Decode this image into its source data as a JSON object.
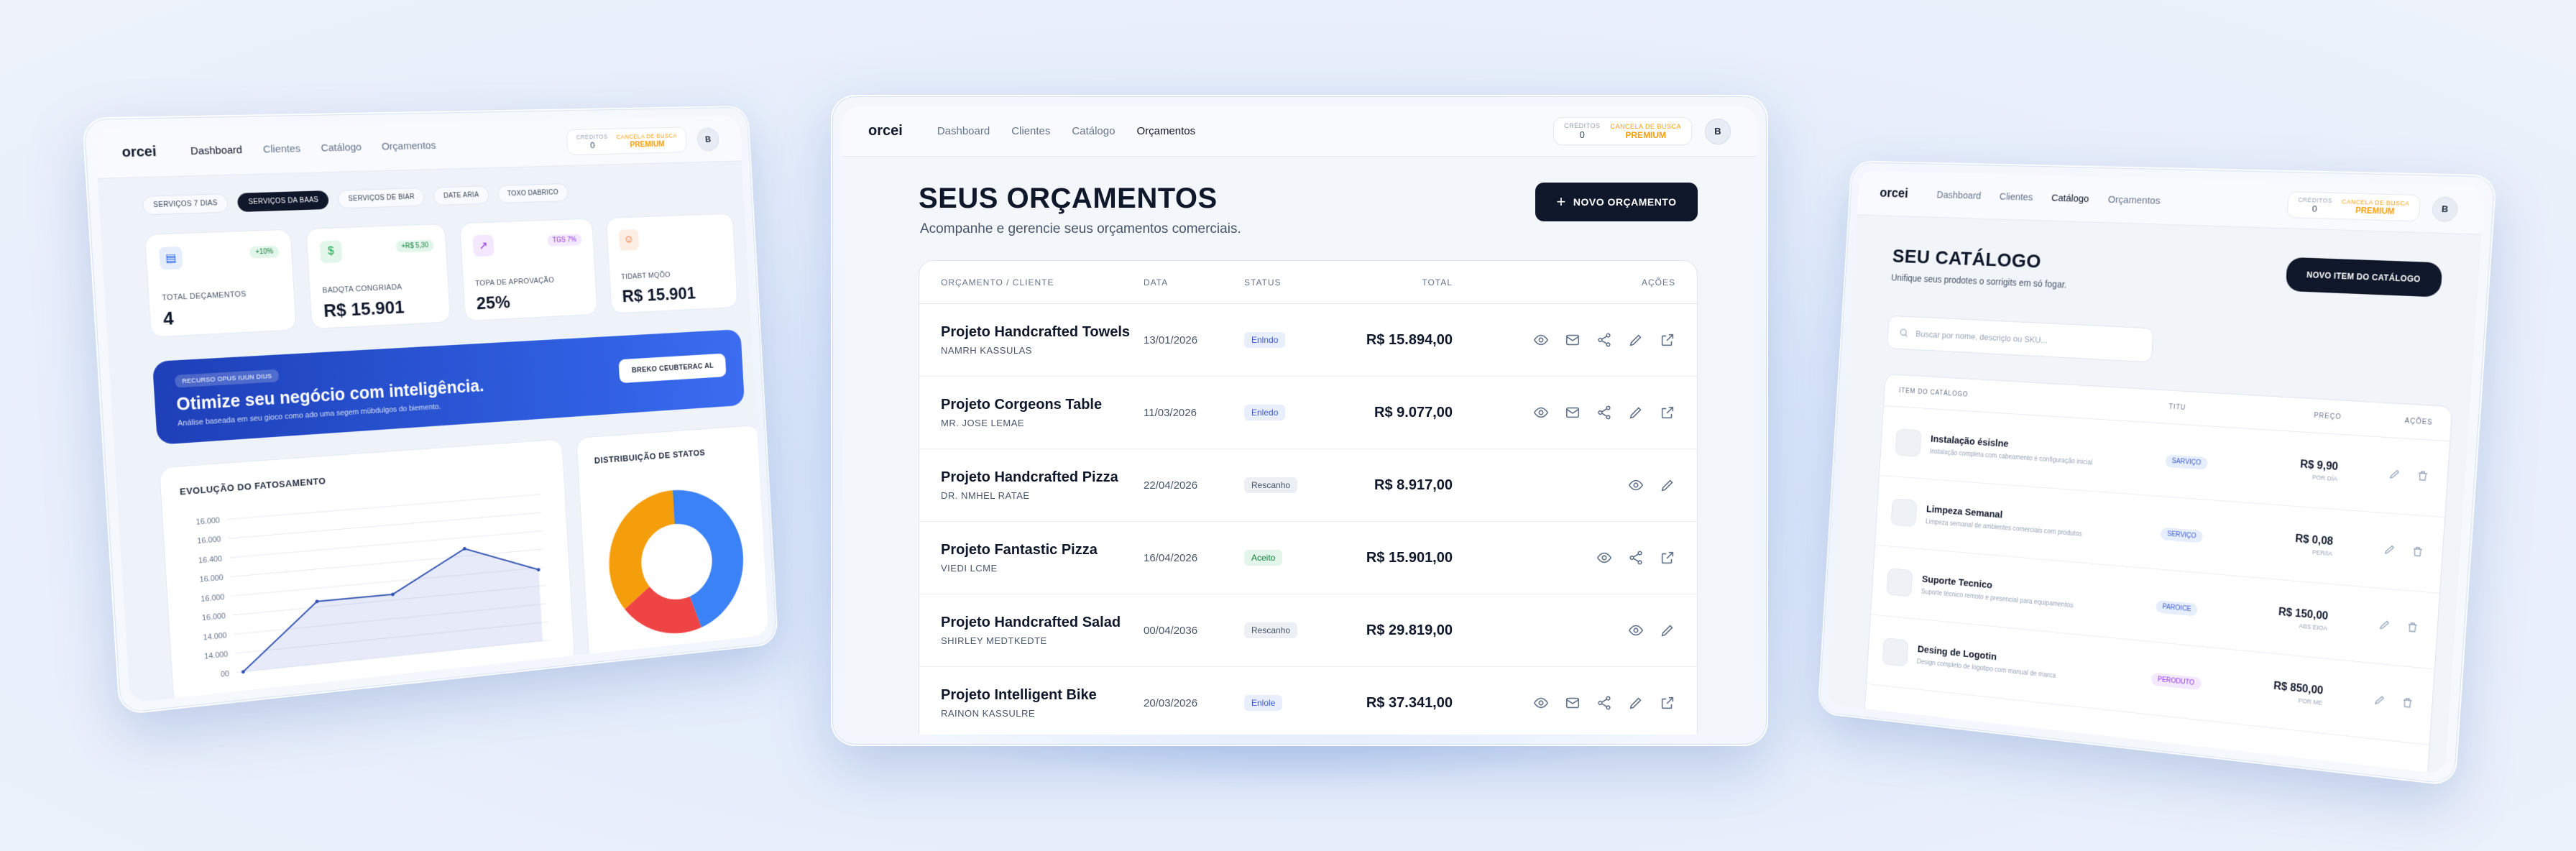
{
  "brand": "orcei",
  "nav": {
    "links": [
      "Dashboard",
      "Clientes",
      "Catálogo",
      "Orçamentos"
    ],
    "credits_label": "CRÉDITOS",
    "credits_value": "0",
    "plan_label": "CANCELA DE BUSCA",
    "plan_value": "PREMIUM",
    "avatar": "B"
  },
  "center": {
    "title": "SEUS ORÇAMENTOS",
    "subtitle": "Acompanhe e gerencie seus orçamentos comerciais.",
    "new_button": "NOVO ORÇAMENTO",
    "columns": [
      "ORÇAMENTO / CLIENTE",
      "DATA",
      "STATUS",
      "TOTAL",
      "AÇÕES"
    ],
    "rows": [
      {
        "project": "Projeto Handcrafted Towels",
        "client": "NAMRH KASSULAS",
        "date": "13/01/2026",
        "status": "Enlndo",
        "total": "R$ 15.894,00",
        "variant": "blue",
        "actions": [
          "eye",
          "mail",
          "share",
          "edit",
          "external"
        ]
      },
      {
        "project": "Projeto Corgeons Table",
        "client": "MR. JOSE LEMAE",
        "date": "11/03/2026",
        "status": "Enledo",
        "total": "R$ 9.077,00",
        "variant": "blue",
        "actions": [
          "eye",
          "mail",
          "share",
          "edit",
          "external"
        ]
      },
      {
        "project": "Projeto Handcrafted Pizza",
        "client": "DR. NMHEL RATAE",
        "date": "22/04/2026",
        "status": "Rescanho",
        "total": "R$ 8.917,00",
        "variant": "gray",
        "actions": [
          "eye",
          "edit"
        ]
      },
      {
        "project": "Projeto Fantastic Pizza",
        "client": "VIEDI LCME",
        "date": "16/04/2026",
        "status": "Aceito",
        "total": "R$ 15.901,00",
        "variant": "green",
        "actions": [
          "eye",
          "share",
          "external"
        ]
      },
      {
        "project": "Projeto Handcrafted Salad",
        "client": "SHIRLEY MEDTKEDTE",
        "date": "00/04/2036",
        "status": "Rescanho",
        "total": "R$ 29.819,00",
        "variant": "gray",
        "actions": [
          "eye",
          "edit"
        ]
      },
      {
        "project": "Projeto Intelligent Bike",
        "client": "RAINON KASSULRE",
        "date": "20/03/2026",
        "status": "Enlole",
        "total": "R$ 37.341,00",
        "variant": "blue",
        "actions": [
          "eye",
          "mail",
          "share",
          "edit",
          "external"
        ]
      }
    ]
  },
  "left": {
    "chips": [
      "SERVIÇOS 7 DIAS",
      "SERVIÇOS DA BAAS",
      "SERVIÇOS DE BIAR",
      "DATE ARIA",
      "TOXO DABRICO"
    ],
    "kpis": [
      {
        "label": "TOTAL DEÇAMENTOS",
        "value": "4",
        "delta": "+10%",
        "icon": "doc-icon",
        "color": "#2563eb",
        "bg": "#e6eefc"
      },
      {
        "label": "BADQTA CONGRIADA",
        "value": "R$ 15.901",
        "delta": "+R$ 5,30",
        "icon": "dollar-icon",
        "color": "#16a34a",
        "bg": "#e3f6ea"
      },
      {
        "label": "TOPA DE APROVAÇÃO",
        "value": "25%",
        "delta": "TGS 7%",
        "icon": "trend-icon",
        "color": "#9333ea",
        "bg": "#f3e8fd"
      },
      {
        "label": "TIDABT MQÕO",
        "value": "R$ 15.901",
        "delta": "",
        "icon": "user-icon",
        "color": "#ea580c",
        "bg": "#fdeee3"
      }
    ],
    "banner": {
      "tag": "RECURSO OPUS IUUN DIUS",
      "title": "Otimize seu negócio com inteligência.",
      "subtitle": "Análise baseada em seu gioco como ado uma segem mübdulgos do biemento.",
      "button": "BREKO CEUBTERAC AL"
    },
    "line_chart": {
      "title": "EVOLUÇÃO DO FATOSAMENTO",
      "y_ticks": [
        "16.000",
        "16.000",
        "16.400",
        "16.000",
        "16.000",
        "16.000",
        "14.000",
        "14.000",
        "00"
      ]
    },
    "pie_title": "DISTRIBUIÇÃO DE STATOS"
  },
  "chart_data": [
    {
      "type": "line",
      "title": "EVOLUÇÃO DO FATOSAMENTO",
      "y_tick_labels": [
        "16.000",
        "16.000",
        "16.400",
        "16.000",
        "16.000",
        "16.000",
        "14.000",
        "14.000",
        "00"
      ],
      "values_relative": [
        0.0,
        0.55,
        0.55,
        0.9,
        0.65
      ],
      "ylim": [
        0,
        1
      ]
    },
    {
      "type": "pie",
      "title": "DISTRIBUIÇÃO DE STATOS",
      "slices": [
        {
          "color": "#3b82f6",
          "value": 45
        },
        {
          "color": "#ef4444",
          "value": 20
        },
        {
          "color": "#f59e0b",
          "value": 35
        }
      ]
    }
  ],
  "right": {
    "title": "SEU CATÁLOGO",
    "subtitle": "Unifique seus prodotes o sorrigits em só fogar.",
    "button": "NOVO ITEM DO CATÁLOGO",
    "search_placeholder": "Buscar por nome, descriçlo ou SKU...",
    "columns": [
      "ITEM DO CATÁLOGO",
      "TITU",
      "PREÇO",
      "AÇÕES"
    ],
    "rows": [
      {
        "name": "Instalação ésislne",
        "desc": "Instalação completa com cabeamento e configuração inicial",
        "type": "SARVIÇO",
        "type_variant": "blue",
        "price": "R$ 9,90",
        "unit": "POR DÍA"
      },
      {
        "name": "Limpeza Semanal",
        "desc": "Limpeza semanal de ambientes comerciais com produtos",
        "type": "SERVIÇO",
        "type_variant": "blue",
        "price": "R$ 0,08",
        "unit": "PER/IA"
      },
      {
        "name": "Suporte Tecnico",
        "desc": "Suporte técnico remoto e presencial para equipamentos",
        "type": "PAROICE",
        "type_variant": "blue",
        "price": "R$ 150,00",
        "unit": "ABS EIOA"
      },
      {
        "name": "Desing de Logotin",
        "desc": "Design completo de logotipo com manual de marca",
        "type": "PERODUTO",
        "type_variant": "purple",
        "price": "R$ 850,00",
        "unit": "POR ME"
      }
    ]
  }
}
